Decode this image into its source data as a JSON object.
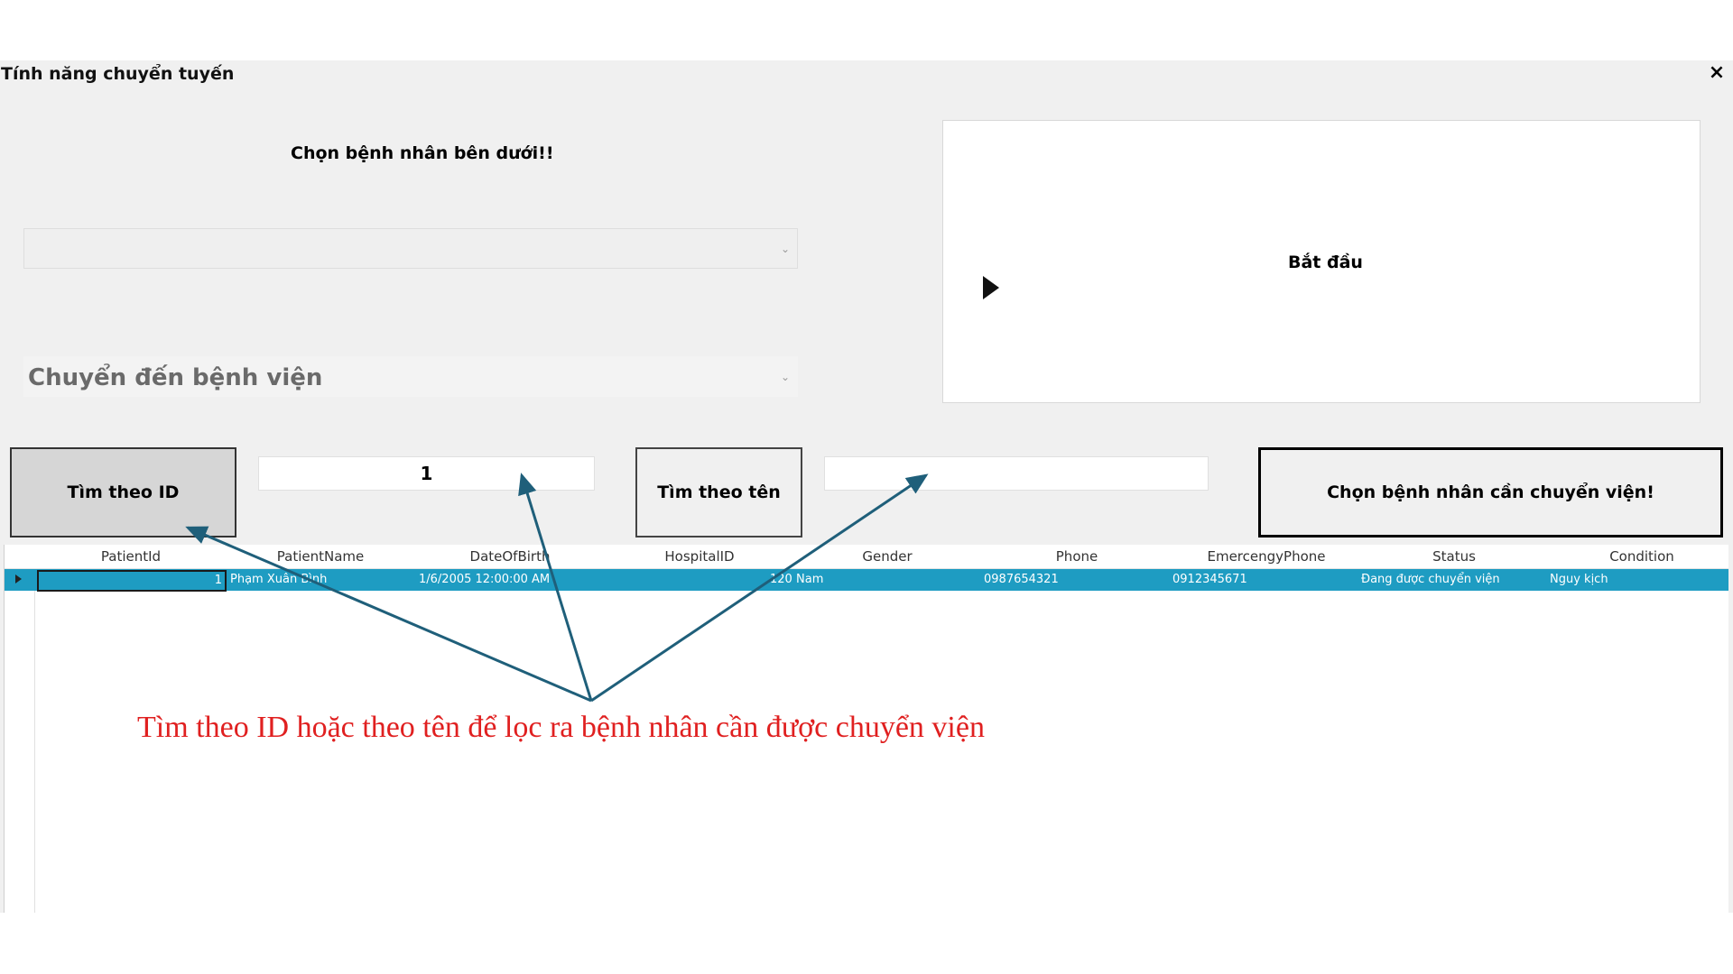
{
  "window": {
    "title": "Tính năng chuyển tuyến",
    "close_label": "×"
  },
  "form": {
    "prompt": "Chọn bệnh nhân bên dưới!!",
    "patient_combo_value": "",
    "hospital_combo_placeholder": "Chuyển đến bệnh viện",
    "start_label": "Bắt đầu"
  },
  "search": {
    "by_id_label": "Tìm theo ID",
    "id_value": "1",
    "by_name_label": "Tìm theo tên",
    "name_value": "",
    "choose_label": "Chọn bệnh nhân cần chuyển viện!"
  },
  "grid": {
    "columns": [
      "PatientId",
      "PatientName",
      "DateOfBirth",
      "HospitalID",
      "Gender",
      "Phone",
      "EmercengyPhone",
      "Status",
      "Condition"
    ],
    "rows": [
      {
        "PatientId": "1",
        "PatientName": "Phạm Xuân Bình",
        "DateOfBirth": "1/6/2005 12:00:00 AM",
        "HospitalID": "120",
        "Gender": "Nam",
        "Phone": "0987654321",
        "EmercengyPhone": "0912345671",
        "Status": "Đang được chuyển viện",
        "Condition": "Nguy kịch"
      }
    ]
  },
  "annotation": {
    "text": "Tìm theo ID hoặc theo tên để lọc ra bệnh nhân cần được chuyển viện",
    "color": "#e02020",
    "arrow_color": "#1f5f7a"
  },
  "colors": {
    "selected_row": "#1e9cc2",
    "window_bg": "#f0f0f0"
  }
}
